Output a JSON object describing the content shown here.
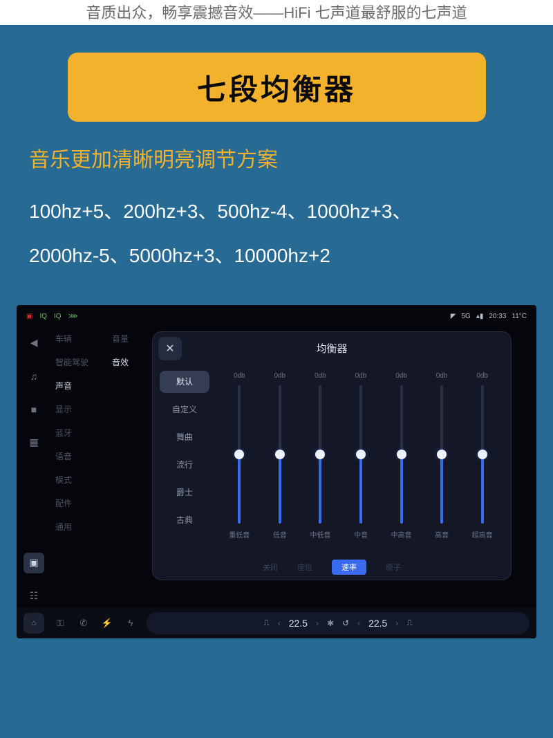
{
  "top_caption": "音质出众，畅享震撼音效——HiFi 七声道最舒服的七声道",
  "banner": "七段均衡器",
  "subtitle": "音乐更加清晰明亮调节方案",
  "eq_line1": "100hz+5、200hz+3、500hz-4、1000hz+3、",
  "eq_line2": "2000hz-5、5000hz+3、10000hz+2",
  "status": {
    "left_iq1": "IQ",
    "left_iq2": "IQ",
    "net": "5G",
    "time": "20:33",
    "temp": "11°C"
  },
  "menu1": {
    "items": [
      "车辆",
      "智能驾驶",
      "声音",
      "显示",
      "蓝牙",
      "语音",
      "模式",
      "配件",
      "通用"
    ],
    "active": 2
  },
  "menu2": {
    "items": [
      "音量",
      "音效"
    ],
    "active": 1
  },
  "modal": {
    "title": "均衡器",
    "presets": [
      "默认",
      "自定义",
      "舞曲",
      "流行",
      "爵士",
      "古典"
    ],
    "preset_active": 0,
    "bands": [
      {
        "db": "0db",
        "name": "重低音"
      },
      {
        "db": "0db",
        "name": "低音"
      },
      {
        "db": "0db",
        "name": "中低音"
      },
      {
        "db": "0db",
        "name": "中音"
      },
      {
        "db": "0db",
        "name": "中高音"
      },
      {
        "db": "0db",
        "name": "高音"
      },
      {
        "db": "0db",
        "name": "超高音"
      }
    ],
    "foot_tabs": [
      "关闭",
      "座位",
      "速率",
      "原子"
    ],
    "foot_active": 2
  },
  "climate": {
    "temp_left": "22.5",
    "temp_right": "22.5"
  }
}
